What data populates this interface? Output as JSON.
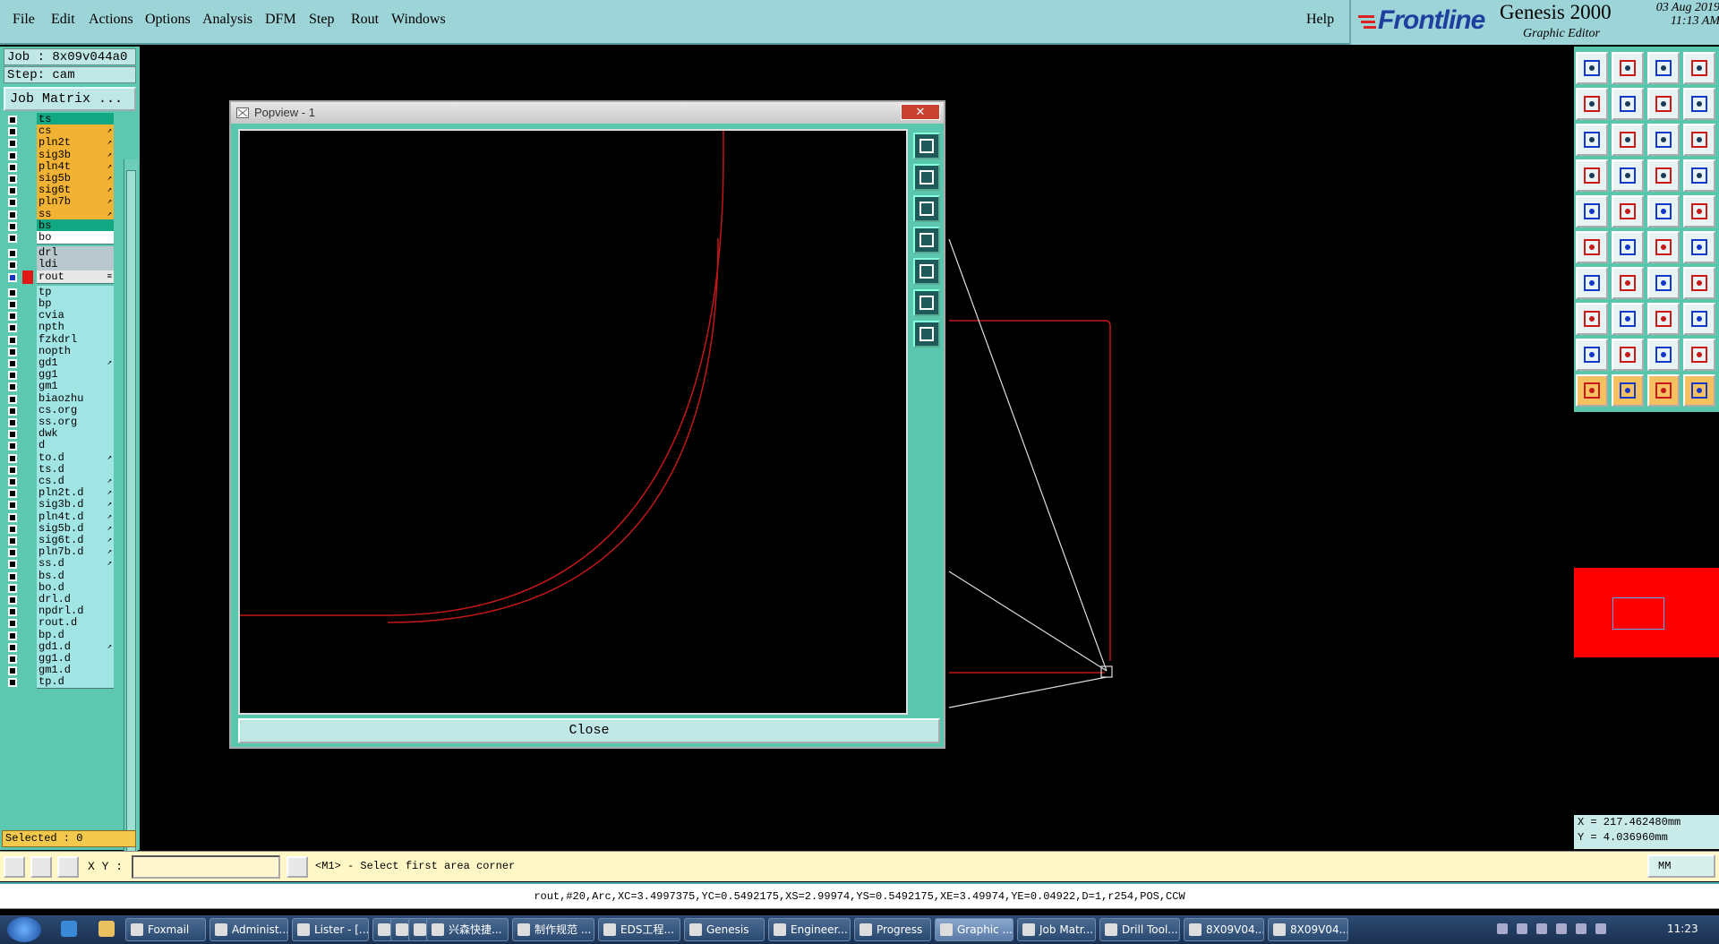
{
  "menubar": {
    "items": [
      "File",
      "Edit",
      "Actions",
      "Options",
      "Analysis",
      "DFM",
      "Step",
      "Rout",
      "Windows"
    ],
    "help": "Help"
  },
  "brand": {
    "logo": "Frontline",
    "product": "Genesis 2000",
    "subtitle": "Graphic Editor",
    "date": "03 Aug 2019",
    "time": "11:13 AM"
  },
  "left_panel": {
    "job": "Job : 8x09v044a0",
    "step": "Step: cam",
    "job_matrix_button": "Job Matrix ...",
    "selected": "Selected : 0",
    "layers": [
      {
        "name": "ts",
        "color": "#13a884",
        "flag": ""
      },
      {
        "name": "cs",
        "color": "#f2b233",
        "flag": "↗"
      },
      {
        "name": "pln2t",
        "color": "#f2b233",
        "flag": "↗"
      },
      {
        "name": "sig3b",
        "color": "#f2b233",
        "flag": "↗"
      },
      {
        "name": "pln4t",
        "color": "#f2b233",
        "flag": "↗"
      },
      {
        "name": "sig5b",
        "color": "#f2b233",
        "flag": "↗"
      },
      {
        "name": "sig6t",
        "color": "#f2b233",
        "flag": "↗"
      },
      {
        "name": "pln7b",
        "color": "#f2b233",
        "flag": "↗"
      },
      {
        "name": "ss",
        "color": "#f2b233",
        "flag": "↗"
      },
      {
        "name": "bs",
        "color": "#13a884",
        "flag": ""
      },
      {
        "name": "bo",
        "color": "#ffffff",
        "flag": ""
      },
      {
        "name": "drl",
        "color": "#b8c8cc",
        "flag": ""
      },
      {
        "name": "ldi",
        "color": "#b8c8cc",
        "flag": ""
      },
      {
        "name": "rout",
        "color": "#e8e8e8",
        "flag": "≡"
      },
      {
        "name": "tp",
        "color": "#a0e4e4",
        "flag": ""
      },
      {
        "name": "bp",
        "color": "#a0e4e4",
        "flag": ""
      },
      {
        "name": "cvia",
        "color": "#a0e4e4",
        "flag": ""
      },
      {
        "name": "npth",
        "color": "#a0e4e4",
        "flag": ""
      },
      {
        "name": "fzkdrl",
        "color": "#a0e4e4",
        "flag": ""
      },
      {
        "name": "nopth",
        "color": "#a0e4e4",
        "flag": ""
      },
      {
        "name": "gd1",
        "color": "#a0e4e4",
        "flag": "↗"
      },
      {
        "name": "gg1",
        "color": "#a0e4e4",
        "flag": ""
      },
      {
        "name": "gm1",
        "color": "#a0e4e4",
        "flag": ""
      },
      {
        "name": "biaozhu",
        "color": "#a0e4e4",
        "flag": ""
      },
      {
        "name": "cs.org",
        "color": "#a0e4e4",
        "flag": ""
      },
      {
        "name": "ss.org",
        "color": "#a0e4e4",
        "flag": ""
      },
      {
        "name": "dwk",
        "color": "#a0e4e4",
        "flag": ""
      },
      {
        "name": "d",
        "color": "#a0e4e4",
        "flag": ""
      },
      {
        "name": "to.d",
        "color": "#a0e4e4",
        "flag": "↗"
      },
      {
        "name": "ts.d",
        "color": "#a0e4e4",
        "flag": ""
      },
      {
        "name": "cs.d",
        "color": "#a0e4e4",
        "flag": "↗"
      },
      {
        "name": "pln2t.d",
        "color": "#a0e4e4",
        "flag": "↗"
      },
      {
        "name": "sig3b.d",
        "color": "#a0e4e4",
        "flag": "↗"
      },
      {
        "name": "pln4t.d",
        "color": "#a0e4e4",
        "flag": "↗"
      },
      {
        "name": "sig5b.d",
        "color": "#a0e4e4",
        "flag": "↗"
      },
      {
        "name": "sig6t.d",
        "color": "#a0e4e4",
        "flag": "↗"
      },
      {
        "name": "pln7b.d",
        "color": "#a0e4e4",
        "flag": "↗"
      },
      {
        "name": "ss.d",
        "color": "#a0e4e4",
        "flag": "↗"
      },
      {
        "name": "bs.d",
        "color": "#a0e4e4",
        "flag": ""
      },
      {
        "name": "bo.d",
        "color": "#a0e4e4",
        "flag": ""
      },
      {
        "name": "drl.d",
        "color": "#a0e4e4",
        "flag": ""
      },
      {
        "name": "npdrl.d",
        "color": "#a0e4e4",
        "flag": ""
      },
      {
        "name": "rout.d",
        "color": "#a0e4e4",
        "flag": ""
      },
      {
        "name": "bp.d",
        "color": "#a0e4e4",
        "flag": ""
      },
      {
        "name": "gd1.d",
        "color": "#a0e4e4",
        "flag": "↗"
      },
      {
        "name": "gg1.d",
        "color": "#a0e4e4",
        "flag": ""
      },
      {
        "name": "gm1.d",
        "color": "#a0e4e4",
        "flag": ""
      },
      {
        "name": "tp.d",
        "color": "#a0e4e4",
        "flag": ""
      }
    ]
  },
  "popview": {
    "title": "Popview - 1",
    "close_x": "✕",
    "close_button": "Close",
    "tool_icons": [
      "fit-window-icon",
      "zoom-up-icon",
      "zoom-down-icon",
      "pan-left-icon",
      "pan-right-icon",
      "zoom-fit-icon",
      "zoom-center-icon"
    ]
  },
  "right_toolbar": {
    "icons": [
      "move-up-icon",
      "move-down-icon",
      "home-icon",
      "layout-icon",
      "move-left-icon",
      "move-right-icon",
      "undo-view-icon",
      "snap-icon",
      "zoom-fit-icon",
      "zoom-center-icon",
      "scale-1to2-icon",
      "help-icon",
      "measure-icon",
      "pad-icon",
      "net-icon",
      "net2-icon",
      "drill-icon",
      "rout-icon",
      "line-icon",
      "circle-icon",
      "node-icon",
      "cross-icon",
      "connect-icon",
      "connect2-icon",
      "angle-icon",
      "slash-icon",
      "arc-icon",
      "text-icon",
      "copy-icon",
      "line-h-icon",
      "pad-array-icon",
      "grid-icon",
      "triangle-icon",
      "triangle2-icon",
      "triangle3-icon",
      "triangle4-icon",
      "select-icon",
      "select-box-icon",
      "select-lasso-icon",
      "select-net-icon"
    ],
    "minimap_color": "#ff0000"
  },
  "coords": {
    "x": "X = 217.462480mm",
    "y": "Y = 4.036960mm"
  },
  "command_bar": {
    "xy_label": "X Y :",
    "xy_value": "",
    "prompt": "<M1> - Select first area corner",
    "units": "MM"
  },
  "status_line": "rout,#20,Arc,XC=3.4997375,YC=0.5492175,XS=2.99974,YS=0.5492175,XE=3.49974,YE=0.04922,D=1,r254,POS,CCW",
  "taskbar": {
    "tasks": [
      "Foxmail",
      "Administ...",
      "Lister - [...",
      "",
      "",
      "",
      "兴森快捷...",
      "制作规范 ...",
      "EDS工程...",
      "Genesis",
      "Engineer...",
      "Progress",
      "Graphic ...",
      "Job Matr...",
      "Drill Tool...",
      "8X09V04...",
      "8X09V04..."
    ],
    "clock": "11:23"
  }
}
